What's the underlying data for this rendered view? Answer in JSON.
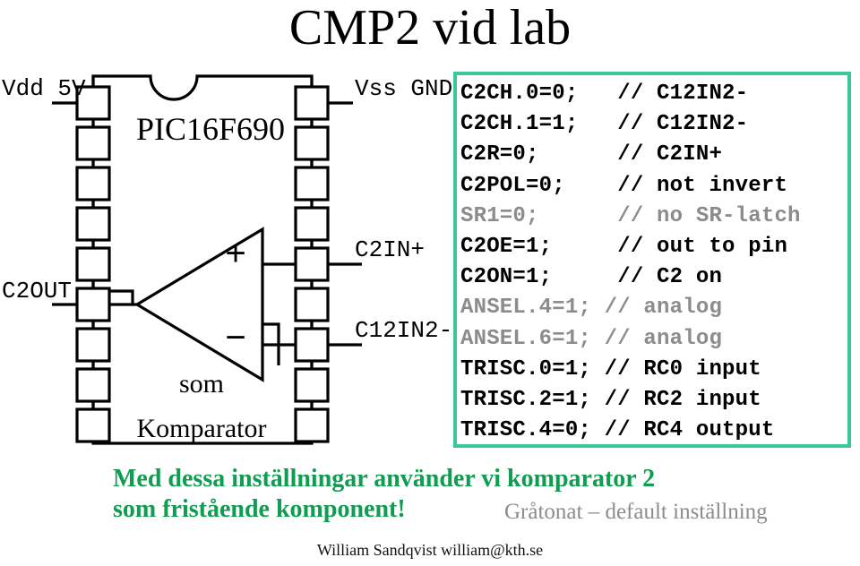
{
  "slide": {
    "title": "CMP2 vid lab",
    "footer": "William Sandqvist  william@kth.se"
  },
  "schematic": {
    "chip_name": "PIC16F690",
    "inner_label_1": "som",
    "inner_label_2": "Komparator",
    "pins": {
      "left_top": "Vdd  5V",
      "left_mid": "C2OUT",
      "right_top": "Vss  GND",
      "right_mid": "C2IN+",
      "right_low": "C12IN2-"
    },
    "comparator": {
      "plus": "+",
      "minus": "−"
    },
    "left_pin_count": 9,
    "right_pin_count": 9
  },
  "code": {
    "border_color": "#3cc79b",
    "black_color": "#000000",
    "gray_color": "#8c8c8c",
    "lines": [
      {
        "text": "C2CH.0=0;   // C12IN2-",
        "style": "black"
      },
      {
        "text": "C2CH.1=1;   // C12IN2-",
        "style": "black"
      },
      {
        "text": "C2R=0;      // C2IN+",
        "style": "black"
      },
      {
        "text": "C2POL=0;    // not invert",
        "style": "black"
      },
      {
        "text": "SR1=0;      // no SR-latch",
        "style": "gray"
      },
      {
        "text": "C2OE=1;     // out to pin",
        "style": "black"
      },
      {
        "text": "C2ON=1;     // C2 on",
        "style": "black"
      },
      {
        "text": "ANSEL.4=1; // analog",
        "style": "gray"
      },
      {
        "text": "ANSEL.6=1; // analog",
        "style": "gray"
      },
      {
        "text": "TRISC.0=1; // RC0 input",
        "style": "black"
      },
      {
        "text": "TRISC.2=1; // RC2 input",
        "style": "black"
      },
      {
        "text": "TRISC.4=0; // RC4 output",
        "style": "black"
      }
    ]
  },
  "statement": {
    "line1": "Med dessa inställningar använder vi komparator 2",
    "line2": "som fristående komponent!",
    "color": "#0f9d52"
  },
  "gray_note": {
    "text": "Gråtonat – default inställning",
    "color": "#8c8c8c"
  }
}
